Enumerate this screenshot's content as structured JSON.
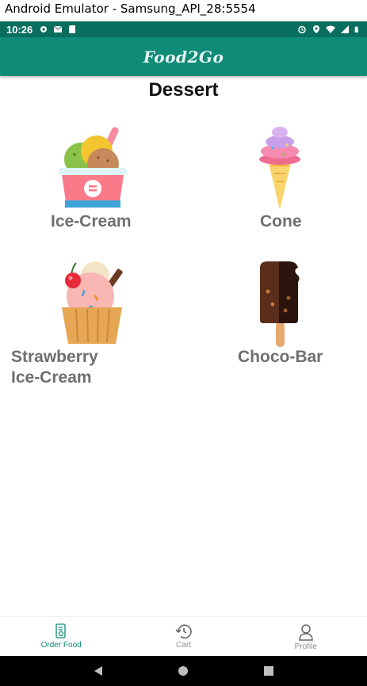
{
  "window": {
    "title": "Android Emulator - Samsung_API_28:5554"
  },
  "status_bar": {
    "time": "10:26",
    "left_icons": [
      "settings-icon",
      "mail-icon",
      "sd-card-icon"
    ],
    "right_icons": [
      "alarm-icon",
      "location-icon",
      "wifi-icon",
      "signal-icon",
      "battery-icon"
    ]
  },
  "app_bar": {
    "title": "Food2Go"
  },
  "page": {
    "title": "Dessert"
  },
  "items": [
    {
      "label": "Ice-Cream",
      "icon": "ice-cream-cup-icon"
    },
    {
      "label": "Cone",
      "icon": "ice-cream-cone-icon"
    },
    {
      "label": "Strawberry\nIce-Cream",
      "icon": "strawberry-ice-cream-icon"
    },
    {
      "label": "Choco-Bar",
      "icon": "choco-bar-icon"
    }
  ],
  "bottom_nav": {
    "items": [
      {
        "label": "Order Food",
        "icon": "order-food-icon",
        "active": true
      },
      {
        "label": "Cart",
        "icon": "history-icon",
        "active": false
      },
      {
        "label": "Profile",
        "icon": "profile-icon",
        "active": false
      }
    ]
  },
  "colors": {
    "primary": "#0e8c78",
    "status_bar": "#0a6e5e",
    "label": "#6f6f6f"
  }
}
